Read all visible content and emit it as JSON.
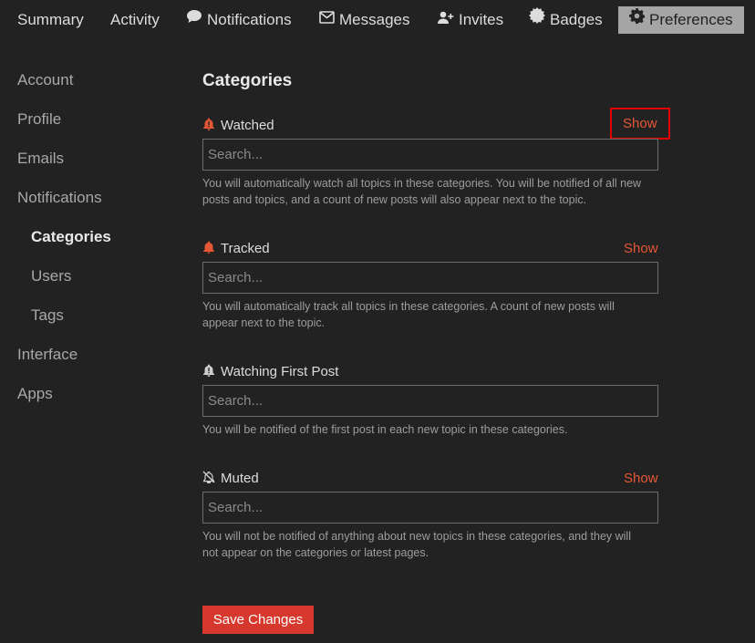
{
  "nav": {
    "summary": "Summary",
    "activity": "Activity",
    "notifications": "Notifications",
    "messages": "Messages",
    "invites": "Invites",
    "badges": "Badges",
    "preferences": "Preferences"
  },
  "sidebar": {
    "items": [
      {
        "label": "Account"
      },
      {
        "label": "Profile"
      },
      {
        "label": "Emails"
      },
      {
        "label": "Notifications"
      },
      {
        "label": "Categories"
      },
      {
        "label": "Users"
      },
      {
        "label": "Tags"
      },
      {
        "label": "Interface"
      },
      {
        "label": "Apps"
      }
    ]
  },
  "main": {
    "title": "Categories",
    "sections": [
      {
        "label": "Watched",
        "show": "Show",
        "placeholder": "Search...",
        "description": "You will automatically watch all topics in these categories. You will be notified of all new posts and topics, and a count of new posts will also appear next to the topic."
      },
      {
        "label": "Tracked",
        "show": "Show",
        "placeholder": "Search...",
        "description": "You will automatically track all topics in these categories. A count of new posts will appear next to the topic."
      },
      {
        "label": "Watching First Post",
        "placeholder": "Search...",
        "description": "You will be notified of the first post in each new topic in these categories."
      },
      {
        "label": "Muted",
        "show": "Show",
        "placeholder": "Search...",
        "description": "You will not be notified of anything about new topics in these categories, and they will not appear on the categories or latest pages."
      }
    ],
    "save_label": "Save Changes"
  },
  "colors": {
    "background": "#222222",
    "accent": "#e45735",
    "button": "#d6382e",
    "active_tab": "#a5a5a5",
    "highlight_box": "#e00000"
  }
}
